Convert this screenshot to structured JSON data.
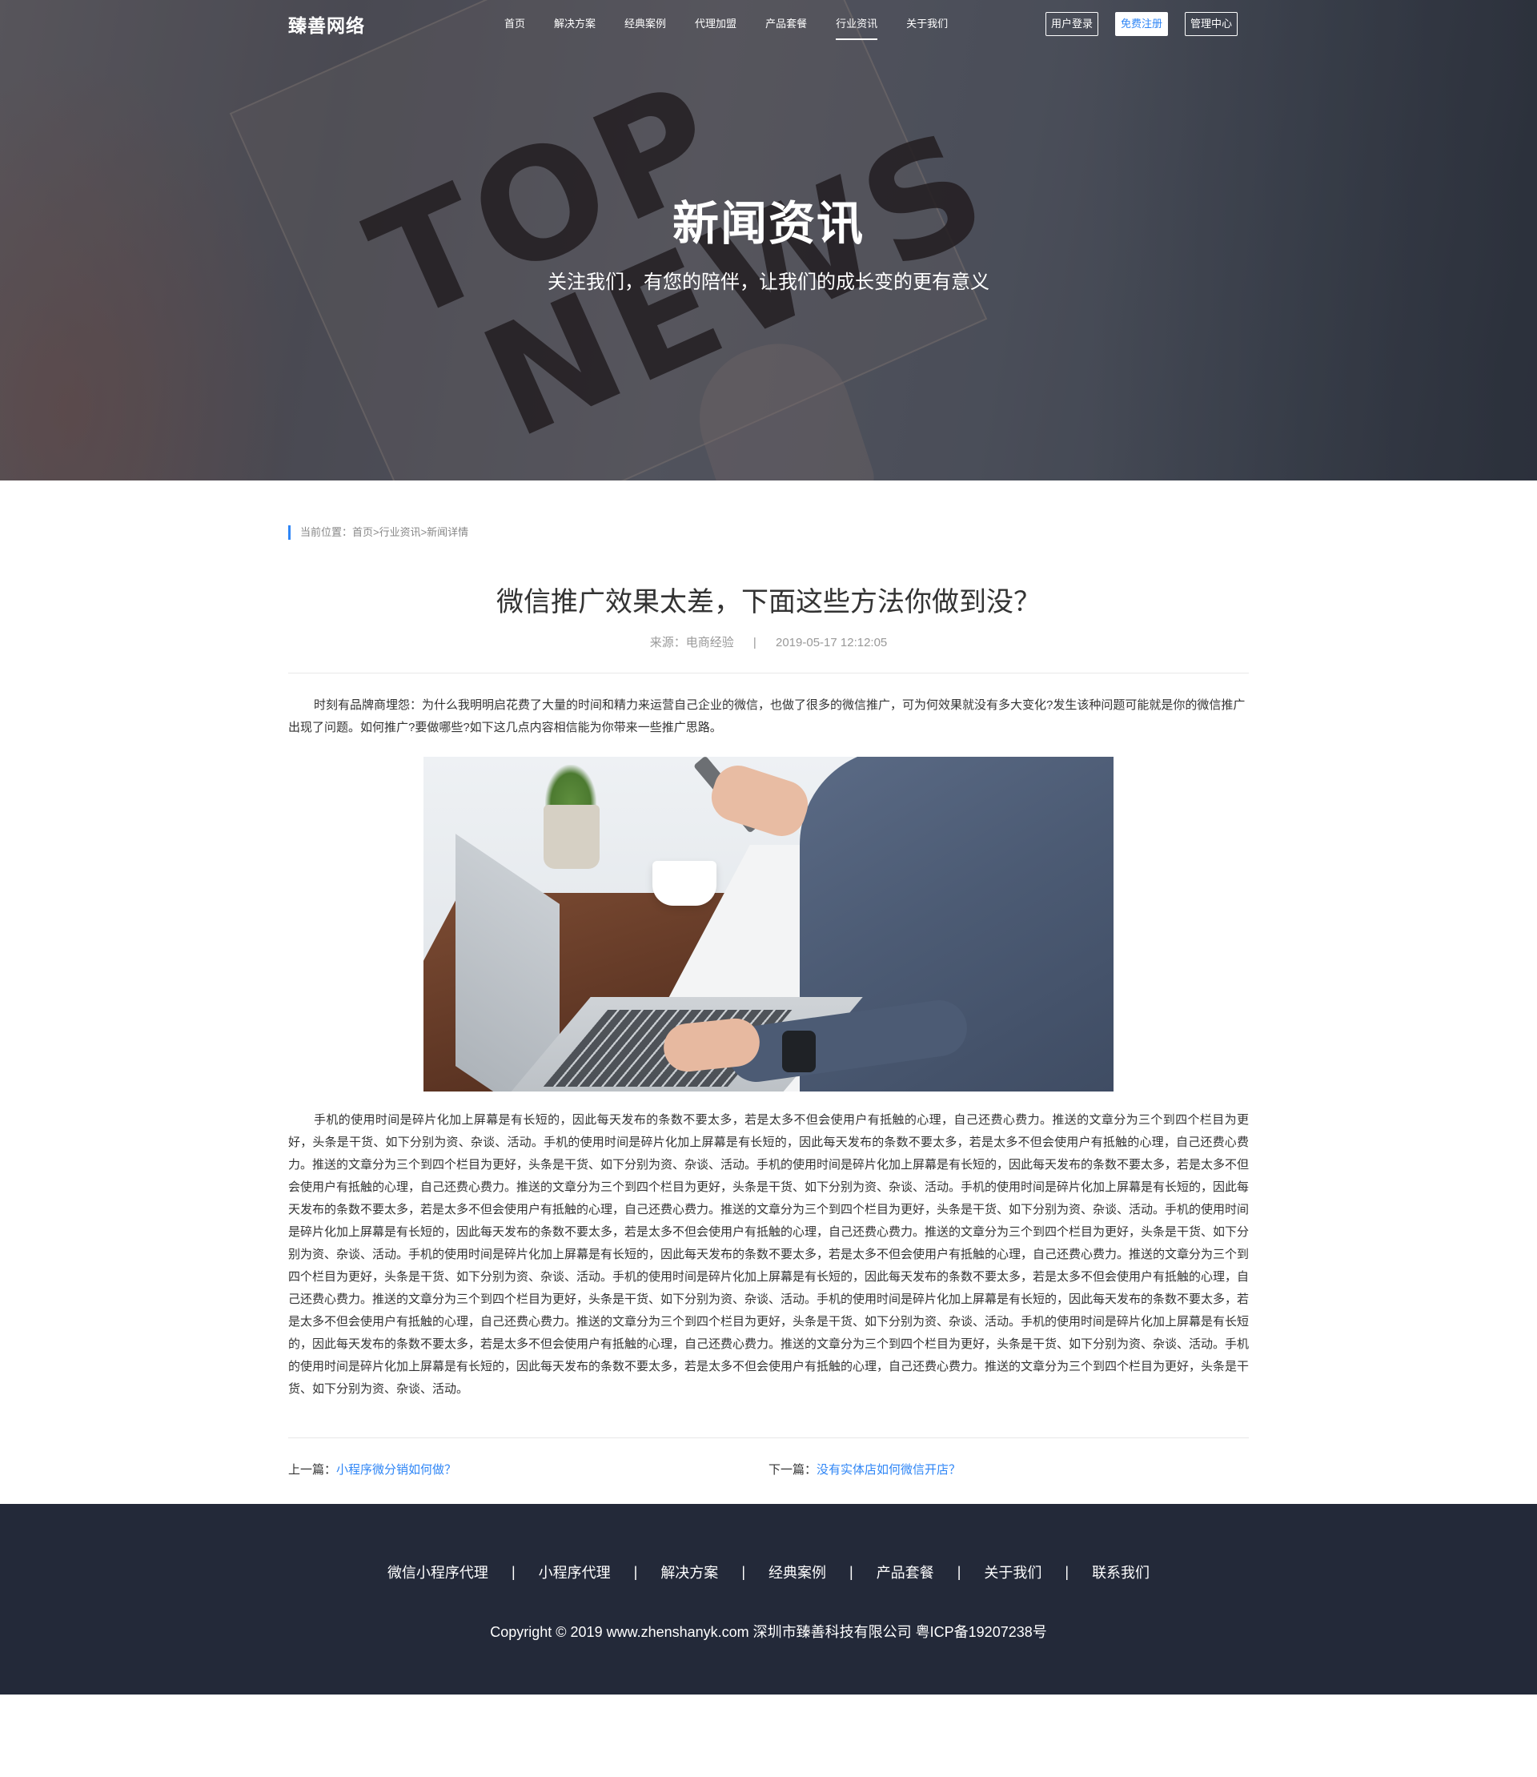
{
  "header": {
    "logo": "臻善网络",
    "nav": [
      "首页",
      "解决方案",
      "经典案例",
      "代理加盟",
      "产品套餐",
      "行业资讯",
      "关于我们"
    ],
    "active_nav": "行业资讯",
    "auth": {
      "login": "用户登录",
      "register": "免费注册",
      "admin": "管理中心"
    }
  },
  "hero": {
    "title": "新闻资讯",
    "subtitle": "关注我们，有您的陪伴，让我们的成长变的更有意义"
  },
  "breadcrumb": "当前位置：首页>行业资讯>新闻详情",
  "article": {
    "title": "微信推广效果太差，下面这些方法你做到没？",
    "source": "来源：电商经验",
    "separator": "|",
    "datetime": "2019-05-17 12:12:05",
    "intro": "时刻有品牌商埋怨：为什么我明明启花费了大量的时间和精力来运营自己企业的微信，也做了很多的微信推广，可为何效果就没有多大变化?发生该种问题可能就是你的微信推广出现了问题。如何推广?要做哪些?如下这几点内容相信能为你带来一些推广思路。",
    "body": "手机的使用时间是碎片化加上屏幕是有长短的，因此每天发布的条数不要太多，若是太多不但会使用户有抵触的心理，自己还费心费力。推送的文章分为三个到四个栏目为更好，头条是干货、如下分别为资、杂谈、活动。手机的使用时间是碎片化加上屏幕是有长短的，因此每天发布的条数不要太多，若是太多不但会使用户有抵触的心理，自己还费心费力。推送的文章分为三个到四个栏目为更好，头条是干货、如下分别为资、杂谈、活动。手机的使用时间是碎片化加上屏幕是有长短的，因此每天发布的条数不要太多，若是太多不但会使用户有抵触的心理，自己还费心费力。推送的文章分为三个到四个栏目为更好，头条是干货、如下分别为资、杂谈、活动。手机的使用时间是碎片化加上屏幕是有长短的，因此每天发布的条数不要太多，若是太多不但会使用户有抵触的心理，自己还费心费力。推送的文章分为三个到四个栏目为更好，头条是干货、如下分别为资、杂谈、活动。手机的使用时间是碎片化加上屏幕是有长短的，因此每天发布的条数不要太多，若是太多不但会使用户有抵触的心理，自己还费心费力。推送的文章分为三个到四个栏目为更好，头条是干货、如下分别为资、杂谈、活动。手机的使用时间是碎片化加上屏幕是有长短的，因此每天发布的条数不要太多，若是太多不但会使用户有抵触的心理，自己还费心费力。推送的文章分为三个到四个栏目为更好，头条是干货、如下分别为资、杂谈、活动。手机的使用时间是碎片化加上屏幕是有长短的，因此每天发布的条数不要太多，若是太多不但会使用户有抵触的心理，自己还费心费力。推送的文章分为三个到四个栏目为更好，头条是干货、如下分别为资、杂谈、活动。手机的使用时间是碎片化加上屏幕是有长短的，因此每天发布的条数不要太多，若是太多不但会使用户有抵触的心理，自己还费心费力。推送的文章分为三个到四个栏目为更好，头条是干货、如下分别为资、杂谈、活动。手机的使用时间是碎片化加上屏幕是有长短的，因此每天发布的条数不要太多，若是太多不但会使用户有抵触的心理，自己还费心费力。推送的文章分为三个到四个栏目为更好，头条是干货、如下分别为资、杂谈、活动。手机的使用时间是碎片化加上屏幕是有长短的，因此每天发布的条数不要太多，若是太多不但会使用户有抵触的心理，自己还费心费力。推送的文章分为三个到四个栏目为更好，头条是干货、如下分别为资、杂谈、活动。"
  },
  "post_nav": {
    "prev_label": "上一篇：",
    "prev_title": "小程序微分销如何做？",
    "next_label": "下一篇：",
    "next_title": "没有实体店如何微信开店？"
  },
  "footer": {
    "links": [
      "微信小程序代理",
      "小程序代理",
      "解决方案",
      "经典案例",
      "产品套餐",
      "关于我们",
      "联系我们"
    ],
    "divider": "|",
    "copyright": "Copyright  ©  2019 www.zhenshanyk.com  深圳市臻善科技有限公司  粤ICP备19207238号"
  },
  "colors": {
    "accent": "#2f86f6",
    "footer_bg": "#232939"
  }
}
